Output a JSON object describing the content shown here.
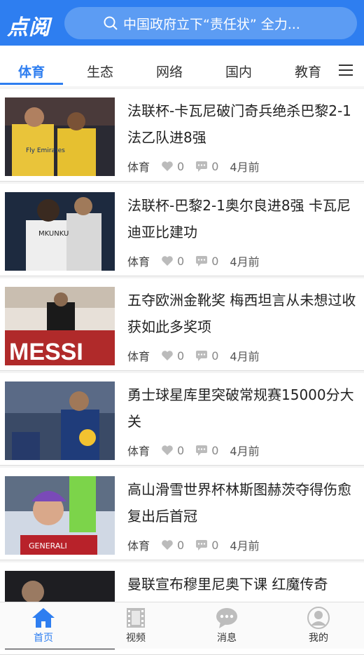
{
  "header": {
    "logo": "点阅",
    "search_text": "中国政府立下“责任状” 全力..."
  },
  "tabs": [
    "体育",
    "生态",
    "网络",
    "国内",
    "教育"
  ],
  "news": [
    {
      "title": "法联杯-卡瓦尼破门奇兵绝杀巴黎2-1法乙队进8强",
      "category": "体育",
      "likes": "0",
      "comments": "0",
      "time": "4月前"
    },
    {
      "title": "法联杯-巴黎2-1奥尔良进8强 卡瓦尼迪亚比建功",
      "category": "体育",
      "likes": "0",
      "comments": "0",
      "time": "4月前"
    },
    {
      "title": "五夺欧洲金靴奖 梅西坦言从未想过收获如此多奖项",
      "category": "体育",
      "likes": "0",
      "comments": "0",
      "time": "4月前"
    },
    {
      "title": "勇士球星库里突破常规赛15000分大关",
      "category": "体育",
      "likes": "0",
      "comments": "0",
      "time": "4月前"
    },
    {
      "title": "高山滑雪世界杯林斯图赫茨夺得伤愈复出后首冠",
      "category": "体育",
      "likes": "0",
      "comments": "0",
      "time": "4月前"
    },
    {
      "title": "曼联宣布穆里尼奥下课 红魔传奇"
    }
  ],
  "bottom_nav": [
    {
      "label": "首页"
    },
    {
      "label": "视频"
    },
    {
      "label": "消息"
    },
    {
      "label": "我的"
    }
  ],
  "colors": {
    "accent": "#2e7ef0"
  },
  "thumb_text": {
    "jersey_brand": "Fly Emirates",
    "jersey_name": "MKUNKU",
    "messi_banner": "MESSI",
    "ski_sponsor": "GENERALI"
  }
}
